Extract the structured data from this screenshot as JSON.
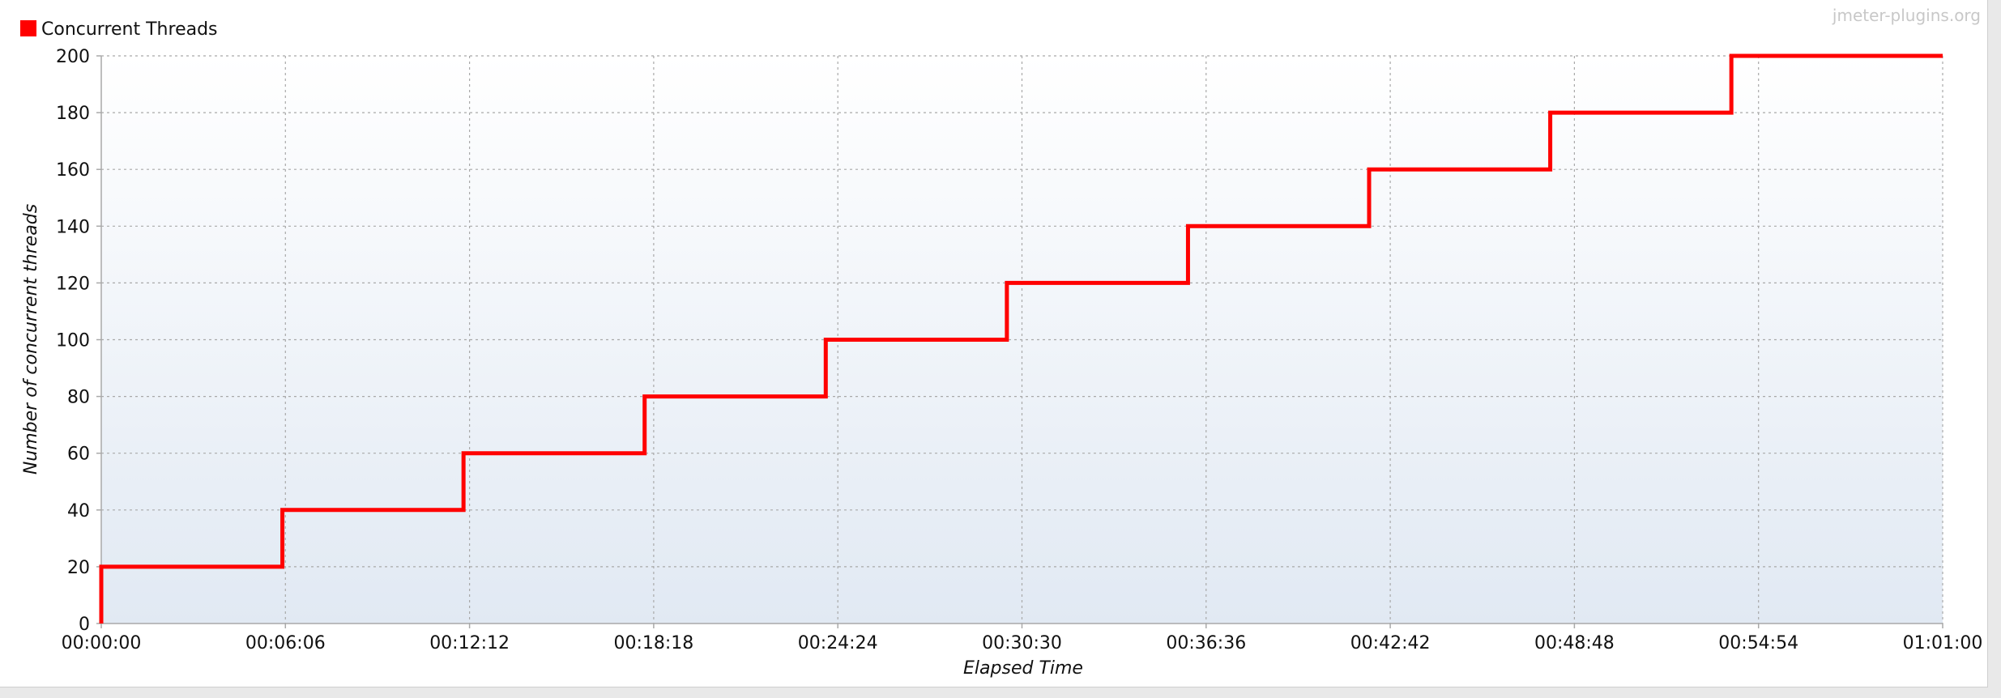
{
  "watermark": "jmeter-plugins.org",
  "colors": {
    "series": "#ff0000",
    "plot_bg_top": "#ffffff",
    "plot_bg_bottom": "#e1e9f3",
    "grid": "#a9a9a9",
    "axis": "#a9a9a9"
  },
  "chart_data": {
    "type": "line",
    "step": true,
    "xlabel": "Elapsed Time",
    "ylabel": "Number of concurrent threads",
    "xlim": [
      "00:00:00",
      "01:01:00"
    ],
    "ylim": [
      0,
      200
    ],
    "grid": true,
    "legend_position": "top-left",
    "x_ticks": [
      "00:00:00",
      "00:06:06",
      "00:12:12",
      "00:18:18",
      "00:24:24",
      "00:30:30",
      "00:36:36",
      "00:42:42",
      "00:48:48",
      "00:54:54",
      "01:01:00"
    ],
    "y_ticks": [
      0,
      20,
      40,
      60,
      80,
      100,
      120,
      140,
      160,
      180,
      200
    ],
    "series": [
      {
        "name": "Concurrent Threads",
        "x": [
          "00:00:00",
          "00:00:00",
          "00:06:00",
          "00:12:00",
          "00:18:00",
          "00:24:00",
          "00:30:00",
          "00:36:00",
          "00:42:00",
          "00:48:00",
          "00:54:00",
          "01:01:00"
        ],
        "y": [
          0,
          20,
          40,
          60,
          80,
          100,
          120,
          140,
          160,
          180,
          200,
          200
        ]
      }
    ]
  }
}
